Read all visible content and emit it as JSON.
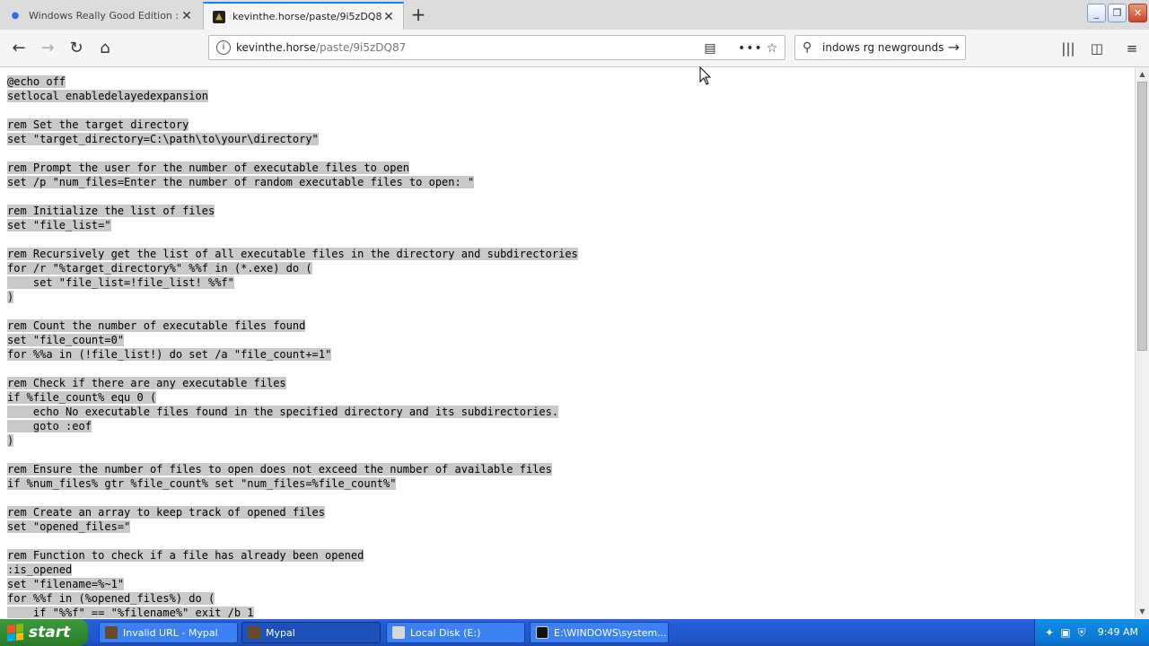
{
  "browser": {
    "tabs": [
      {
        "title": "Windows Really Good Edition : Ja",
        "active": false
      },
      {
        "title": "kevinthe.horse/paste/9i5zDQ87",
        "active": true
      }
    ],
    "url": {
      "domain": "kevinthe.horse",
      "path": "/paste/9i5zDQ87"
    },
    "search_text": "indows rg newgrounds"
  },
  "code_lines": [
    "@echo off",
    "setlocal enabledelayedexpansion",
    "",
    "rem Set the target directory",
    "set \"target_directory=C:\\path\\to\\your\\directory\"",
    "",
    "rem Prompt the user for the number of executable files to open",
    "set /p \"num_files=Enter the number of random executable files to open: \"",
    "",
    "rem Initialize the list of files",
    "set \"file_list=\"",
    "",
    "rem Recursively get the list of all executable files in the directory and subdirectories",
    "for /r \"%target_directory%\" %%f in (*.exe) do (",
    "    set \"file_list=!file_list! %%f\"",
    ")",
    "",
    "rem Count the number of executable files found",
    "set \"file_count=0\"",
    "for %%a in (!file_list!) do set /a \"file_count+=1\"",
    "",
    "rem Check if there are any executable files",
    "if %file_count% equ 0 (",
    "    echo No executable files found in the specified directory and its subdirectories.",
    "    goto :eof",
    ")",
    "",
    "rem Ensure the number of files to open does not exceed the number of available files",
    "if %num_files% gtr %file_count% set \"num_files=%file_count%\"",
    "",
    "rem Create an array to keep track of opened files",
    "set \"opened_files=\"",
    "",
    "rem Function to check if a file has already been opened",
    ":is_opened",
    "set \"filename=%~1\"",
    "for %%f in (%opened_files%) do (",
    "    if \"%%f\" == \"%filename%\" exit /b 1"
  ],
  "taskbar": {
    "start_label": "start",
    "items": [
      {
        "label": "Invalid URL - Mypal",
        "active": false,
        "icon": "mypal-icon"
      },
      {
        "label": "Mypal",
        "active": true,
        "icon": "mypal-icon"
      },
      {
        "label": "Local Disk (E:)",
        "active": false,
        "icon": "drive-icon"
      },
      {
        "label": "E:\\WINDOWS\\system...",
        "active": false,
        "icon": "console-icon"
      }
    ],
    "clock": "9:49 AM"
  }
}
